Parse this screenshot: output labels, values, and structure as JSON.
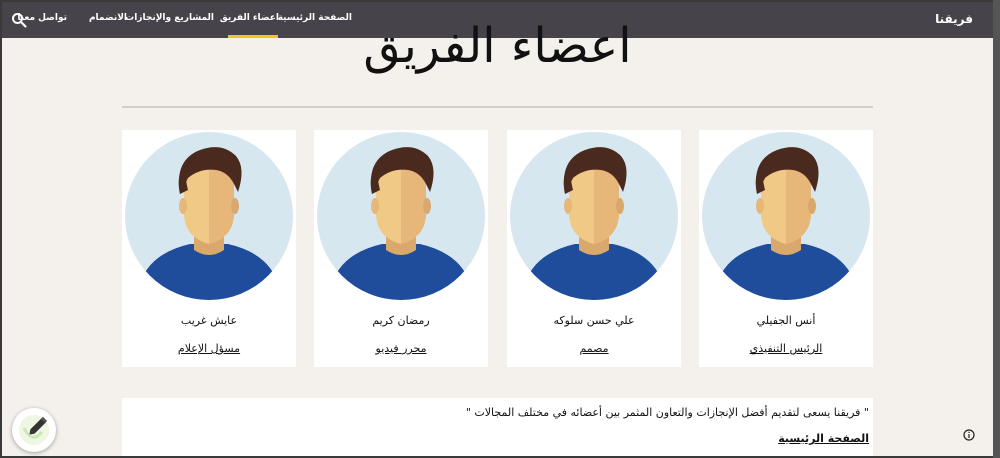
{
  "navbar": {
    "brand": "فريقنا",
    "items": [
      {
        "label": "الصفحة الرئيسية"
      },
      {
        "label": "اعضاء الفريق"
      },
      {
        "label": "المشاريع والإنجازات"
      },
      {
        "label": "الانضمام"
      },
      {
        "label": "تواصل معنا"
      }
    ],
    "active_index": 1,
    "search_icon": "search-icon"
  },
  "main": {
    "heading": "اعضاء الفريق"
  },
  "members": [
    {
      "name": "أنس الجفيلي",
      "role": "الرئيس التنفيذي"
    },
    {
      "name": "علي حسن سلوكه",
      "role": "مصمم"
    },
    {
      "name": "رمضان كريم",
      "role": "محرر فيديو"
    },
    {
      "name": "عايش غريب",
      "role": "مسؤل الإعلام"
    }
  ],
  "quote": {
    "text": "\" فريقنا يسعى لتقديم أفضل الإنجازات والتعاون المثمر بين أعضائه في مختلف المجالات \"",
    "home_link": "الصفحة الرئيسية"
  },
  "colors": {
    "navbar_bg": "#47434a",
    "accent": "#f5c518",
    "page_bg": "#f4f0ec",
    "avatar_bg": "#d7e7ef",
    "shirt": "#1f4d9b",
    "hair": "#4a2a1e",
    "skin": "#f1c987"
  },
  "icons": [
    "search-icon",
    "pencil-icon",
    "info-icon",
    "avatar-icon"
  ]
}
